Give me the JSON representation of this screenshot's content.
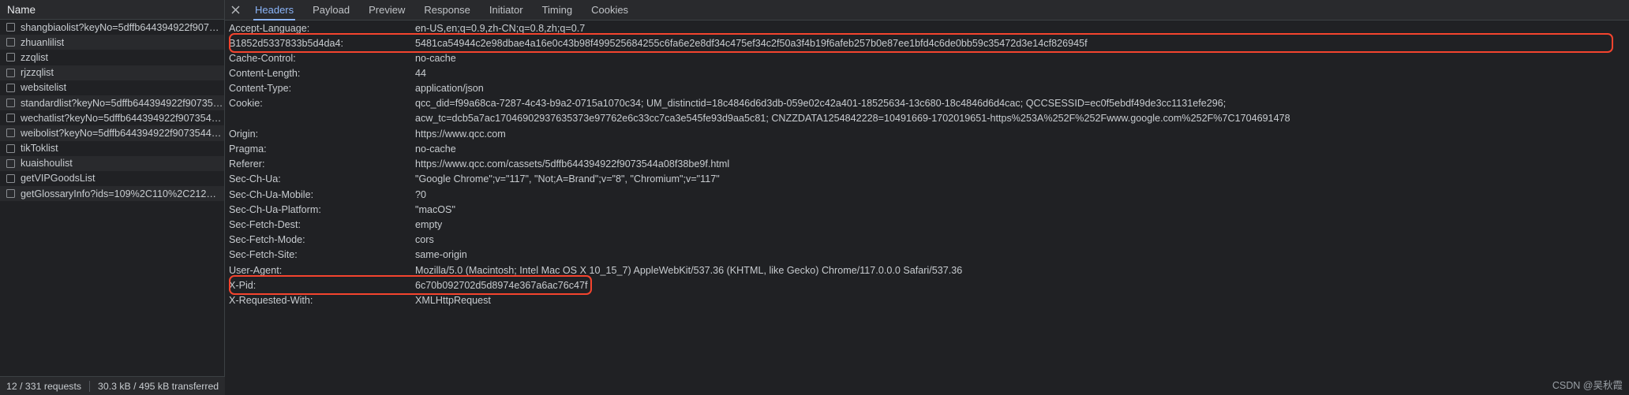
{
  "left_panel": {
    "column_header": "Name",
    "requests": [
      {
        "label": "shangbiaolist?keyNo=5dffb644394922f9073544…"
      },
      {
        "label": "zhuanlilist"
      },
      {
        "label": "zzqlist"
      },
      {
        "label": "rjzzqlist"
      },
      {
        "label": "websitelist"
      },
      {
        "label": "standardlist?keyNo=5dffb644394922f9073544a…"
      },
      {
        "label": "wechatlist?keyNo=5dffb644394922f9073544a0…"
      },
      {
        "label": "weibolist?keyNo=5dffb644394922f9073544a08f…"
      },
      {
        "label": "tikToklist"
      },
      {
        "label": "kuaishoulist"
      },
      {
        "label": "getVIPGoodsList"
      },
      {
        "label": "getGlossaryInfo?ids=109%2C110%2C212%2C…"
      }
    ],
    "status_bar": {
      "requests": "12 / 331 requests",
      "transferred": "30.3 kB / 495 kB transferred"
    }
  },
  "detail_panel": {
    "close_icon": "close-icon",
    "tabs": [
      {
        "label": "Headers",
        "active": true
      },
      {
        "label": "Payload",
        "active": false
      },
      {
        "label": "Preview",
        "active": false
      },
      {
        "label": "Response",
        "active": false
      },
      {
        "label": "Initiator",
        "active": false
      },
      {
        "label": "Timing",
        "active": false
      },
      {
        "label": "Cookies",
        "active": false
      }
    ],
    "headers": [
      {
        "name": "Accept-Language:",
        "value": "en-US,en;q=0.9,zh-CN;q=0.8,zh;q=0.7",
        "highlighted": false
      },
      {
        "name": "B1852d5337833b5d4da4:",
        "value": "5481ca54944c2e98dbae4a16e0c43b98f499525684255c6fa6e2e8df34c475ef34c2f50a3f4b19f6afeb257b0e87ee1bfd4c6de0bb59c35472d3e14cf826945f",
        "highlighted": true
      },
      {
        "name": "Cache-Control:",
        "value": "no-cache",
        "highlighted": false
      },
      {
        "name": "Content-Length:",
        "value": "44",
        "highlighted": false
      },
      {
        "name": "Content-Type:",
        "value": "application/json",
        "highlighted": false
      },
      {
        "name": "Cookie:",
        "value_line1": "qcc_did=f99a68ca-7287-4c43-b9a2-0715a1070c34; UM_distinctid=18c4846d6d3db-059e02c42a401-18525634-13c680-18c4846d6d4cac; QCCSESSID=ec0f5ebdf49de3cc1131efe296;",
        "value_line2": "acw_tc=dcb5a7ac17046902937635373e97762e6c33cc7ca3e545fe93d9aa5c81; CNZZDATA1254842228=10491669-1702019651-https%253A%252F%252Fwww.google.com%252F%7C1704691478",
        "highlighted": false,
        "multiline": true
      },
      {
        "name": "Origin:",
        "value": "https://www.qcc.com",
        "highlighted": false
      },
      {
        "name": "Pragma:",
        "value": "no-cache",
        "highlighted": false
      },
      {
        "name": "Referer:",
        "value": "https://www.qcc.com/cassets/5dffb644394922f9073544a08f38be9f.html",
        "highlighted": false
      },
      {
        "name": "Sec-Ch-Ua:",
        "value": "\"Google Chrome\";v=\"117\", \"Not;A=Brand\";v=\"8\", \"Chromium\";v=\"117\"",
        "highlighted": false
      },
      {
        "name": "Sec-Ch-Ua-Mobile:",
        "value": "?0",
        "highlighted": false
      },
      {
        "name": "Sec-Ch-Ua-Platform:",
        "value": "\"macOS\"",
        "highlighted": false
      },
      {
        "name": "Sec-Fetch-Dest:",
        "value": "empty",
        "highlighted": false
      },
      {
        "name": "Sec-Fetch-Mode:",
        "value": "cors",
        "highlighted": false
      },
      {
        "name": "Sec-Fetch-Site:",
        "value": "same-origin",
        "highlighted": false
      },
      {
        "name": "User-Agent:",
        "value": "Mozilla/5.0 (Macintosh; Intel Mac OS X 10_15_7) AppleWebKit/537.36 (KHTML, like Gecko) Chrome/117.0.0.0 Safari/537.36",
        "highlighted": false
      },
      {
        "name": "X-Pid:",
        "value": "6c70b092702d5d8974e367a6ac76c47f",
        "highlighted": true
      },
      {
        "name": "X-Requested-With:",
        "value": "XMLHttpRequest",
        "highlighted": false
      }
    ]
  },
  "watermark": "CSDN @吴秋霞",
  "colors": {
    "accent": "#8ab4f8",
    "highlight": "#f4442e",
    "background": "#202124",
    "row_alt": "#292a2d",
    "text": "#c8ccd0"
  }
}
